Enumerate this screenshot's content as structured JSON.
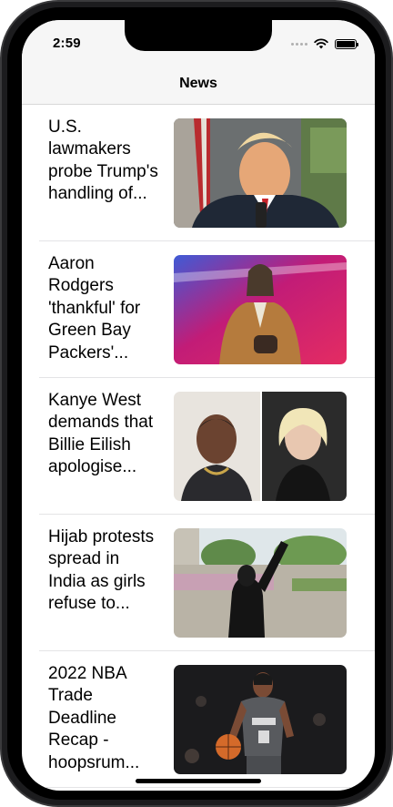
{
  "status_bar": {
    "time": "2:59"
  },
  "nav": {
    "title": "News"
  },
  "articles": [
    {
      "title": "U.S. lawmakers probe Trump's handling of...",
      "image": "politician-at-podium-photo"
    },
    {
      "title": "Aaron Rodgers 'thankful' for Green Bay Packers'...",
      "image": "man-at-awards-stage-photo"
    },
    {
      "title": "Kanye West demands that Billie Eilish apologise...",
      "image": "two-celebrity-portraits-photo"
    },
    {
      "title": "Hijab protests spread in India as girls refuse to...",
      "image": "protest-crowd-photo"
    },
    {
      "title": "2022 NBA Trade Deadline Recap - hoopsrum...",
      "image": "basketball-player-photo"
    }
  ]
}
